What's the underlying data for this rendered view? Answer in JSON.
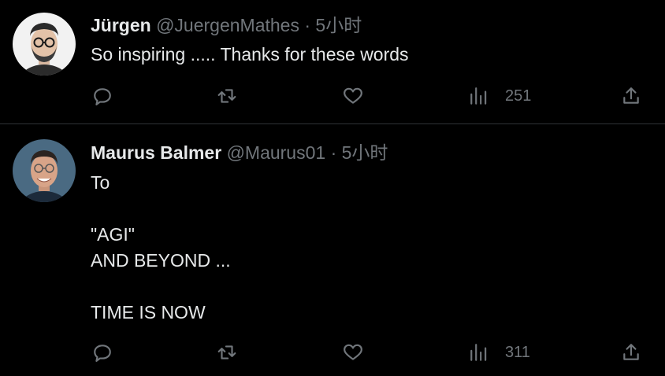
{
  "tweets": [
    {
      "name": "Jürgen",
      "handle": "@JuergenMathes",
      "separator": "·",
      "time": "5小时",
      "text": "So inspiring ..... Thanks for these words",
      "views": "251",
      "avatar_icon": "avatar-glasses-beard"
    },
    {
      "name": "Maurus Balmer",
      "handle": "@Maurus01",
      "separator": "·",
      "time": "5小时",
      "text": "To\n\n\"AGI\"\nAND BEYOND ...\n\nTIME IS NOW",
      "views": "311",
      "avatar_icon": "avatar-glasses-smiling"
    }
  ],
  "icons": {
    "reply": "reply-icon",
    "retweet": "retweet-icon",
    "like": "heart-icon",
    "views": "views-icon",
    "share": "share-icon"
  },
  "colors": {
    "background": "#000000",
    "text": "#e7e9ea",
    "secondary": "#71767b",
    "divider": "#2f3336"
  }
}
